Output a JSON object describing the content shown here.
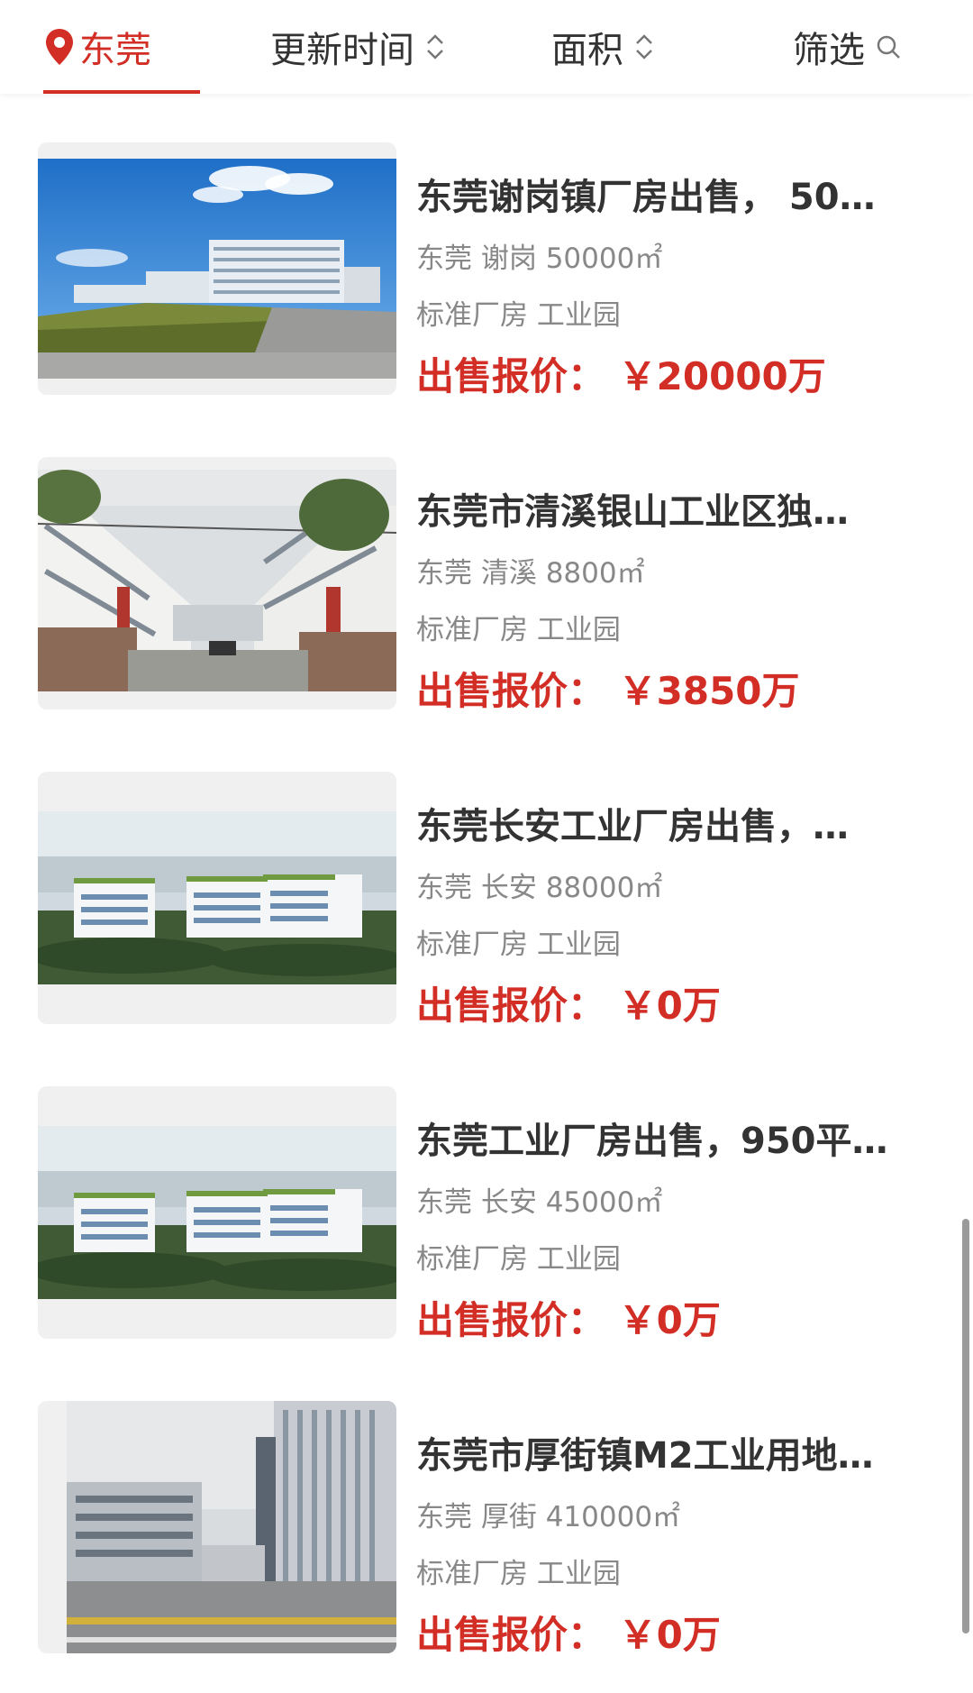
{
  "filter_bar": {
    "city": "东莞",
    "update_time": "更新时间",
    "area": "面积",
    "filter": "筛选"
  },
  "colors": {
    "accent": "#d22e25",
    "title": "#333333",
    "meta": "#888888"
  },
  "listings": [
    {
      "title": "东莞谢岗镇厂房出售， 50…",
      "location": "东莞 谢岗 50000㎡",
      "tags": "标准厂房 工业园",
      "price_label": "出售报价：",
      "price_value": "￥20000万"
    },
    {
      "title": "东莞市清溪银山工业区独…",
      "location": "东莞 清溪 8800㎡",
      "tags": "标准厂房 工业园",
      "price_label": "出售报价：",
      "price_value": "￥3850万"
    },
    {
      "title": "东莞长安工业厂房出售，…",
      "location": "东莞 长安 88000㎡",
      "tags": "标准厂房 工业园",
      "price_label": "出售报价：",
      "price_value": "￥0万"
    },
    {
      "title": "东莞工业厂房出售，950平…",
      "location": "东莞 长安 45000㎡",
      "tags": "标准厂房 工业园",
      "price_label": "出售报价：",
      "price_value": "￥0万"
    },
    {
      "title": "东莞市厚街镇M2工业用地…",
      "location": "东莞 厚街 410000㎡",
      "tags": "标准厂房 工业园",
      "price_label": "出售报价：",
      "price_value": "￥0万"
    }
  ]
}
